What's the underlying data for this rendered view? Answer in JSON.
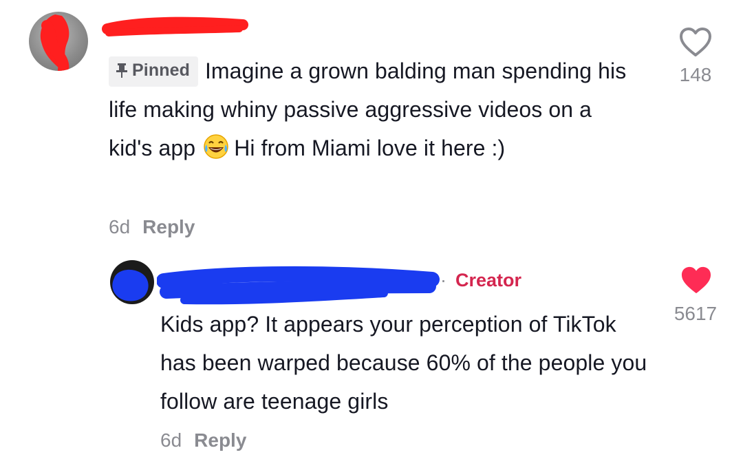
{
  "top_comment": {
    "pinned_label": "Pinned",
    "text_first": "Imagine a grown balding man spending his life making whiny passive aggressive videos on a kid's app",
    "text_second": "Hi from Miami love it here :)",
    "time": "6d",
    "reply_label": "Reply",
    "like_count": "148",
    "like_icon": "heart-outline-icon"
  },
  "reply_comment": {
    "creator_label": "Creator",
    "dot": "·",
    "text": "Kids app? It appears your perception of TikTok has been warped because 60% of the people you follow are teenage girls",
    "time": "6d",
    "reply_label": "Reply",
    "like_count": "5617",
    "like_icon": "heart-filled-icon"
  },
  "colors": {
    "text": "#161823",
    "muted": "#8a8b91",
    "creator": "#d4264f",
    "liked_heart": "#fe2c55",
    "redact_red": "#ff1f1f",
    "redact_blue": "#1a3cf0"
  }
}
